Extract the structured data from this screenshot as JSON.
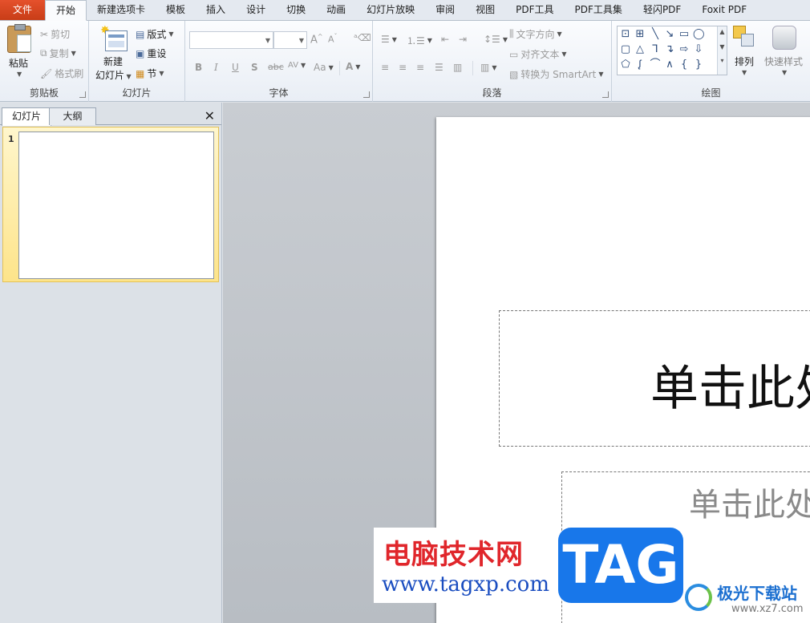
{
  "tabs": {
    "file": "文件",
    "home": "开始",
    "new_tab": "新建选项卡",
    "template": "模板",
    "insert": "插入",
    "design": "设计",
    "transitions": "切换",
    "animations": "动画",
    "slideshow": "幻灯片放映",
    "review": "审阅",
    "view": "视图",
    "pdf_tools": "PDF工具",
    "pdf_toolset": "PDF工具集",
    "lightpdf": "轻闪PDF",
    "foxit": "Foxit PDF"
  },
  "clipboard": {
    "paste": "粘贴",
    "cut": "剪切",
    "copy": "复制",
    "format_painter": "格式刷",
    "label": "剪贴板"
  },
  "slides_group": {
    "new_slide_line1": "新建",
    "new_slide_line2": "幻灯片",
    "layout": "版式",
    "reset": "重设",
    "section": "节",
    "label": "幻灯片"
  },
  "font_group": {
    "bold": "B",
    "italic": "I",
    "underline": "U",
    "shadow": "S",
    "strikethrough": "abc",
    "spacing": "AV",
    "case": "Aa",
    "color": "A",
    "label": "字体"
  },
  "paragraph_group": {
    "text_direction": "文字方向",
    "align_text": "对齐文本",
    "smartart": "转换为 SmartArt",
    "label": "段落"
  },
  "drawing_group": {
    "arrange": "排列",
    "quick_styles": "快速样式",
    "label": "绘图"
  },
  "left_pane": {
    "tab_slides": "幻灯片",
    "tab_outline": "大纲",
    "slide_number": "1"
  },
  "slide": {
    "title_placeholder": "单击此处",
    "subtitle_placeholder": "单击此处"
  },
  "watermark": {
    "site_cn": "电脑技术网",
    "site_url": "www.tagxp.com",
    "tag": "TAG",
    "brand": "极光下载站",
    "domain": "www.xz7.com"
  },
  "colors": {
    "file_tab": "#d9481f",
    "ribbon": "#f3f6fa",
    "selected_thumb": "#fde48a",
    "watermark_blue": "#1877ea"
  }
}
